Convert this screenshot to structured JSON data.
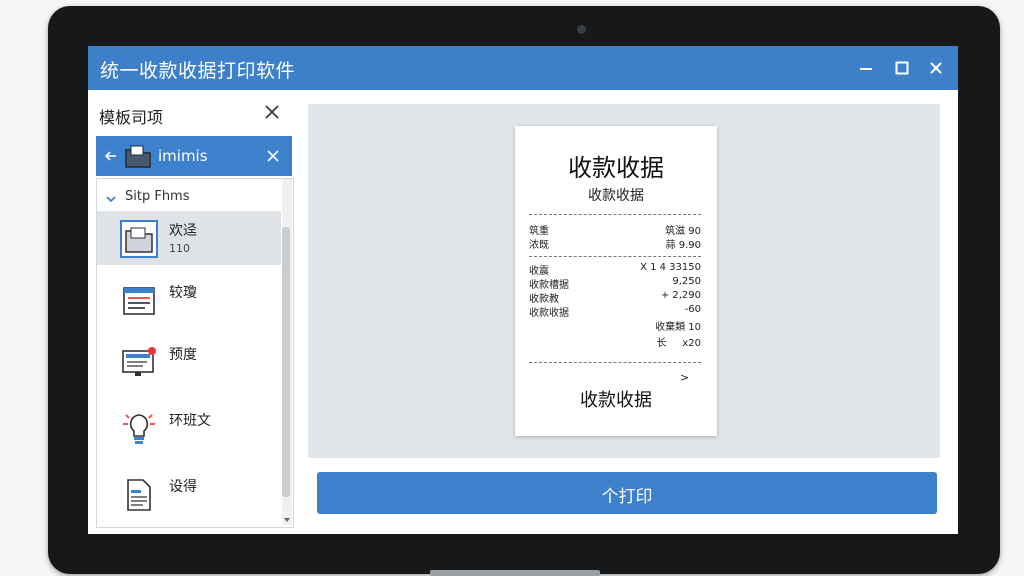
{
  "window": {
    "title": "统一收款收据打印软件"
  },
  "sidebar": {
    "title": "模板司项",
    "file_tab": {
      "label": "imimis"
    },
    "section": {
      "label": "Sitp Fhms"
    },
    "items": [
      {
        "label": "欢迳",
        "sub": "110",
        "icon": "folder-icon",
        "selected": true
      },
      {
        "label": "较瓊",
        "icon": "form-list-icon"
      },
      {
        "label": "预度",
        "icon": "monitor-icon"
      },
      {
        "label": "环班文",
        "icon": "lightbulb-icon"
      },
      {
        "label": "设得",
        "icon": "document-icon"
      }
    ]
  },
  "receipt": {
    "title": "收款收据",
    "subtitle": "收款收据",
    "rows_a": [
      {
        "k": "筑重",
        "v": "筑滋 90"
      },
      {
        "k": "浓既",
        "v": "蒜 9.90"
      }
    ],
    "rows_b": [
      {
        "k": "收震",
        "v": "X 1 4 33150"
      },
      {
        "k": "收款槽据",
        "v": "9,250"
      },
      {
        "k": "收款教",
        "v": "+ 2,290"
      },
      {
        "k": "收款收据",
        "v": "-60"
      },
      {
        "k": "",
        "v": "收棄類 10"
      },
      {
        "k": "",
        "v": "长     x20"
      }
    ],
    "arrow": ">",
    "footer": "收款收据"
  },
  "actions": {
    "print_label": "个打印"
  },
  "colors": {
    "accent": "#3d80cc",
    "titlebar": "#3d7fc9",
    "preview_bg": "#e3e6e9"
  }
}
